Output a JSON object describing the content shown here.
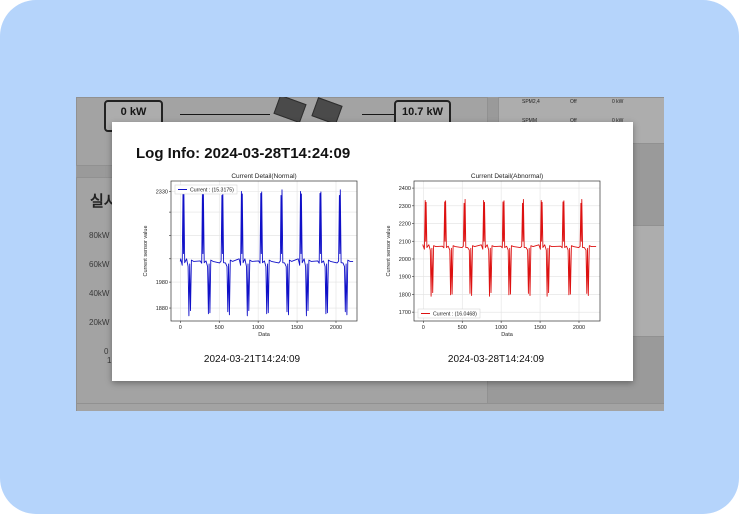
{
  "background": {
    "power_left": "0 kW",
    "power_right": "10.7 kW",
    "section_title_fragment": "실시",
    "y_labels": [
      "80kW",
      "60kW",
      "40kW",
      "20kW"
    ],
    "zero_fragment": "0",
    "one_fragment": "1",
    "table_rows": [
      {
        "name": "SPM2,4",
        "status": "Off",
        "value": "0 kW"
      },
      {
        "name": "SPMM",
        "status": "Off",
        "value": "0 kW"
      }
    ]
  },
  "modal": {
    "title": "Log Info: 2024-03-28T14:24:09"
  },
  "chart_data": [
    {
      "type": "line",
      "title": "Current Detail(Normal)",
      "xlabel": "Data",
      "ylabel": "Current sensor value",
      "xlim": [
        -120,
        2270
      ],
      "ylim": [
        1830,
        2370
      ],
      "xticks": [
        0,
        500,
        1000,
        1500,
        2000
      ],
      "yticks": [
        1880,
        1980,
        2070,
        2160,
        2250,
        2330
      ],
      "ytick_labels": [
        "1880",
        "1980",
        "",
        "",
        "",
        "2330"
      ],
      "grid": true,
      "legend": "top-left",
      "color": "#1010c8",
      "series": [
        {
          "name": "Current : (15.3175)"
        }
      ],
      "peaks_x": [
        40,
        290,
        540,
        790,
        1040,
        1300,
        1550,
        1800,
        2050
      ],
      "base": 2060,
      "peak_high": 2330,
      "peak_low": 1850,
      "x_end": 2220,
      "caption": "2024-03-21T14:24:09"
    },
    {
      "type": "line",
      "title": "Current Detail(Abnormal)",
      "xlabel": "Data",
      "ylabel": "Current sensor value",
      "xlim": [
        -120,
        2270
      ],
      "ylim": [
        1650,
        2440
      ],
      "xticks": [
        0,
        500,
        1000,
        1500,
        2000
      ],
      "yticks": [
        1700,
        1800,
        1900,
        2000,
        2100,
        2200,
        2300,
        2400
      ],
      "grid": true,
      "legend": "bottom-left",
      "color": "#dd1111",
      "series": [
        {
          "name": "Current : (16.0468)"
        }
      ],
      "peaks_x": [
        30,
        280,
        530,
        780,
        1030,
        1280,
        1520,
        1800,
        2030
      ],
      "base": 2070,
      "peak_high": 2330,
      "peak_low": 1790,
      "x_end": 2220,
      "caption": "2024-03-28T14:24:09"
    }
  ]
}
